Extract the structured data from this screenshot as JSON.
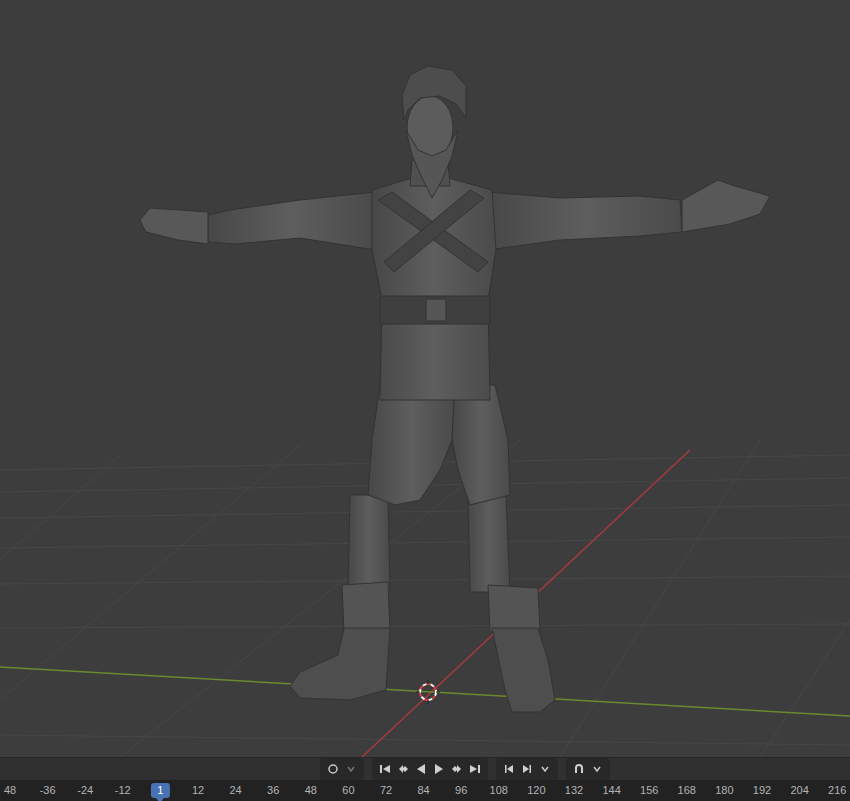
{
  "timeline": {
    "frames": [
      {
        "label": "48",
        "selected": false
      },
      {
        "label": "-36",
        "selected": false
      },
      {
        "label": "-24",
        "selected": false
      },
      {
        "label": "-12",
        "selected": false
      },
      {
        "label": "1",
        "selected": true
      },
      {
        "label": "12",
        "selected": false
      },
      {
        "label": "24",
        "selected": false
      },
      {
        "label": "36",
        "selected": false
      },
      {
        "label": "48",
        "selected": false
      },
      {
        "label": "60",
        "selected": false
      },
      {
        "label": "72",
        "selected": false
      },
      {
        "label": "84",
        "selected": false
      },
      {
        "label": "96",
        "selected": false
      },
      {
        "label": "108",
        "selected": false
      },
      {
        "label": "120",
        "selected": false
      },
      {
        "label": "132",
        "selected": false
      },
      {
        "label": "144",
        "selected": false
      },
      {
        "label": "156",
        "selected": false
      },
      {
        "label": "168",
        "selected": false
      },
      {
        "label": "180",
        "selected": false
      },
      {
        "label": "192",
        "selected": false
      },
      {
        "label": "204",
        "selected": false
      },
      {
        "label": "216",
        "selected": false
      }
    ]
  }
}
